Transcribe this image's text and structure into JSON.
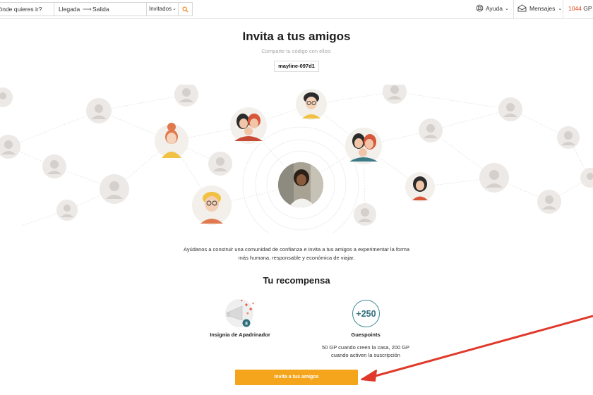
{
  "header": {
    "search_placeholder": "¿A dónde quieres ir?",
    "checkin_label": "Llegada",
    "checkout_label": "Salida",
    "guests_label": "Invitados",
    "help_label": "Ayuda",
    "messages_label": "Mensajes",
    "points_value": "1044",
    "points_unit": "GP"
  },
  "invite": {
    "title": "Invita a tus amigos",
    "subtitle": "Comparte tu código con ellos:",
    "code": "mayline-097d1"
  },
  "description": {
    "line1": "Ayúdanos a construir una comunidad de confianza e invita a tus amigos a experimentar la forma",
    "line2": "más humana, responsable y económica de viajar."
  },
  "reward": {
    "title": "Tu recompensa",
    "badge_label": "Insignia de Apadrinador",
    "badge_count": "8",
    "points_amount": "+250",
    "points_label": "Guespoints",
    "points_desc_line1": "50 GP cuando creen la casa, 200 GP",
    "points_desc_line2": "cuando activen la suscripción"
  },
  "cta": {
    "label": "Invita a tus amigos"
  },
  "colors": {
    "accent": "#f4a51c",
    "points_red": "#e04a1f",
    "teal": "#3d8a95",
    "annotation_arrow": "#e0392b",
    "avatar_bg": "#ece9e6"
  }
}
